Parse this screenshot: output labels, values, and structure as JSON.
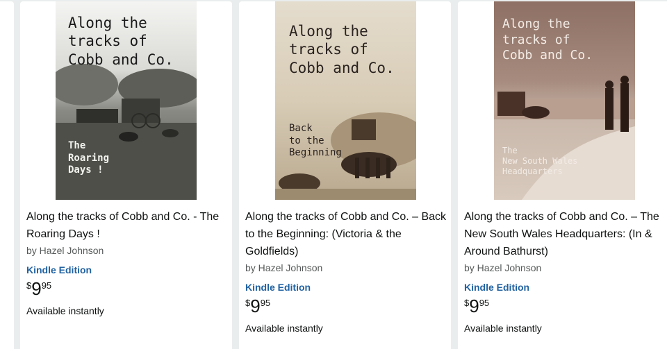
{
  "books": [
    {
      "cover_title": "Along the\ntracks of\nCobb and Co.",
      "cover_subtitle": "The\nRoaring\nDays !",
      "title": "Along the tracks of Cobb and Co. - The Roaring Days !",
      "author": "by Hazel Johnson",
      "format": "Kindle Edition",
      "price_symbol": "$",
      "price_whole": "9",
      "price_fraction": "95",
      "availability": "Available instantly"
    },
    {
      "cover_title": "Along the\ntracks of\nCobb and Co.",
      "cover_subtitle": "Back\nto the\nBeginning",
      "title": "Along the tracks of Cobb and Co. – Back to the Beginning: (Victoria & the Goldfields)",
      "author": "by Hazel Johnson",
      "format": "Kindle Edition",
      "price_symbol": "$",
      "price_whole": "9",
      "price_fraction": "95",
      "availability": "Available instantly"
    },
    {
      "cover_title": "Along the\ntracks of\nCobb and Co.",
      "cover_subtitle": "The\nNew South Wales\nHeadquarters",
      "title": "Along the tracks of Cobb and Co. – The New South Wales Headquarters: (In & Around Bathurst)",
      "author": "by Hazel Johnson",
      "format": "Kindle Edition",
      "price_symbol": "$",
      "price_whole": "9",
      "price_fraction": "95",
      "availability": "Available instantly"
    }
  ],
  "colors": {
    "link": "#2162a1",
    "text": "#0f1111",
    "muted": "#565959",
    "background": "#eaeded"
  }
}
